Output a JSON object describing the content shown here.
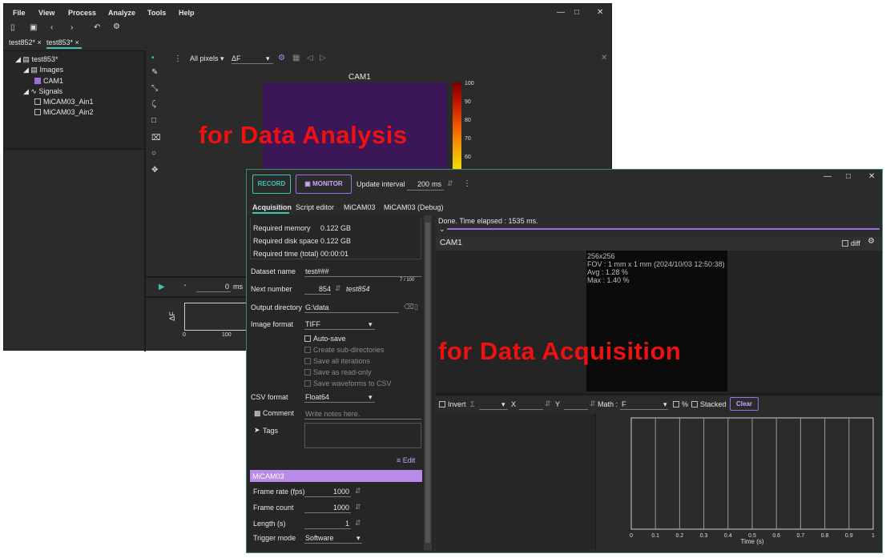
{
  "analysis": {
    "menu": [
      "File",
      "View",
      "Process",
      "Analyze",
      "Tools",
      "Help"
    ],
    "window_controls": [
      "—",
      "□",
      "✕"
    ],
    "tabs": [
      {
        "label": "test852*",
        "close": "×"
      },
      {
        "label": "test853*",
        "close": "×"
      }
    ],
    "tree": {
      "root": "test853*",
      "images_label": "Images",
      "cam": "CAM1",
      "signals_label": "Signals",
      "signal_items": [
        "MiCAM03_Ain1",
        "MiCAM03_Ain2"
      ]
    },
    "view_toolbar": {
      "pixels": "All pixels",
      "mode": "ΔF",
      "close": "✕"
    },
    "image_title": "CAM1",
    "colorbar_ticks": [
      "100",
      "90",
      "80",
      "70",
      "60"
    ],
    "playback": {
      "value": "0",
      "unit": "ms"
    },
    "plot": {
      "ylabel": "ΔF",
      "xticks": [
        "0",
        "100"
      ]
    },
    "overlay_label": "for Data Analysis"
  },
  "acquisition": {
    "record_label": "RECORD",
    "monitor_label": "MONITOR",
    "update_interval_label": "Update interval",
    "update_interval_value": "200",
    "update_interval_unit": "ms",
    "more": "⋮",
    "window_controls": [
      "—",
      "□",
      "✕"
    ],
    "tabs": [
      "Acquisition",
      "Script editor",
      "MiCAM03",
      "MiCAM03 (Debug)"
    ],
    "summary": [
      {
        "label": "Required memory",
        "value": "0.122 GB"
      },
      {
        "label": "Required disk space",
        "value": "0.122 GB"
      },
      {
        "label": "Required time (total)",
        "value": "00:00:01"
      }
    ],
    "dataset_name_label": "Dataset name",
    "dataset_name_value": "test###",
    "dataset_counter": "7 / 100",
    "next_number_label": "Next number",
    "next_number_value": "854",
    "next_number_preview": "test854",
    "output_dir_label": "Output directory",
    "output_dir_value": "G:\\data",
    "image_format_label": "Image format",
    "image_format_value": "TIFF",
    "options": [
      {
        "label": "Auto-save",
        "enabled": true
      },
      {
        "label": "Create sub-directories",
        "enabled": false
      },
      {
        "label": "Save all iterations",
        "enabled": false
      },
      {
        "label": "Save as read-only",
        "enabled": false
      },
      {
        "label": "Save waveforms to CSV",
        "enabled": false
      }
    ],
    "csv_format_label": "CSV format",
    "csv_format_value": "Float64",
    "comment_label": "Comment",
    "comment_placeholder": "Write notes here.",
    "tags_label": "Tags",
    "edit_label": "Edit",
    "device_header": "MiCAM03",
    "device_fields": [
      {
        "label": "Frame rate (fps)",
        "value": "1000"
      },
      {
        "label": "Frame count",
        "value": "1000"
      },
      {
        "label": "Length (s)",
        "value": "1"
      }
    ],
    "trigger_label": "Trigger mode",
    "trigger_value": "Software",
    "status_text": "Done. Time elapsed : 1535 ms.",
    "cam_title": "CAM1",
    "diff_label": "diff",
    "image_info": [
      "256x256",
      "FOV : 1 mm x 1 mm (2024/10/03 12:50:38)",
      "Avg : 1.28 %",
      "Max : 1.40 %"
    ],
    "toolbar": {
      "invert": "Invert",
      "sigma": "Σ",
      "x": "X",
      "y": "Y",
      "math_label": "Math :",
      "math_value": "F",
      "percent": "%",
      "stacked": "Stacked",
      "clear": "Clear"
    },
    "overlay_label": "for Data Acquisition"
  },
  "chart_data": {
    "type": "line",
    "xlabel": "Time (s)",
    "ylabel": "",
    "xlim": [
      0,
      1
    ],
    "xticks": [
      "0",
      "0.1",
      "0.2",
      "0.3",
      "0.4",
      "0.5",
      "0.6",
      "0.7",
      "0.8",
      "0.9",
      "1"
    ],
    "series": [],
    "grid": true
  },
  "colors": {
    "accent": "#9b6fe0",
    "record": "#3cc8b0",
    "overlay": "#ee1111",
    "device_header": "#b88be8"
  }
}
